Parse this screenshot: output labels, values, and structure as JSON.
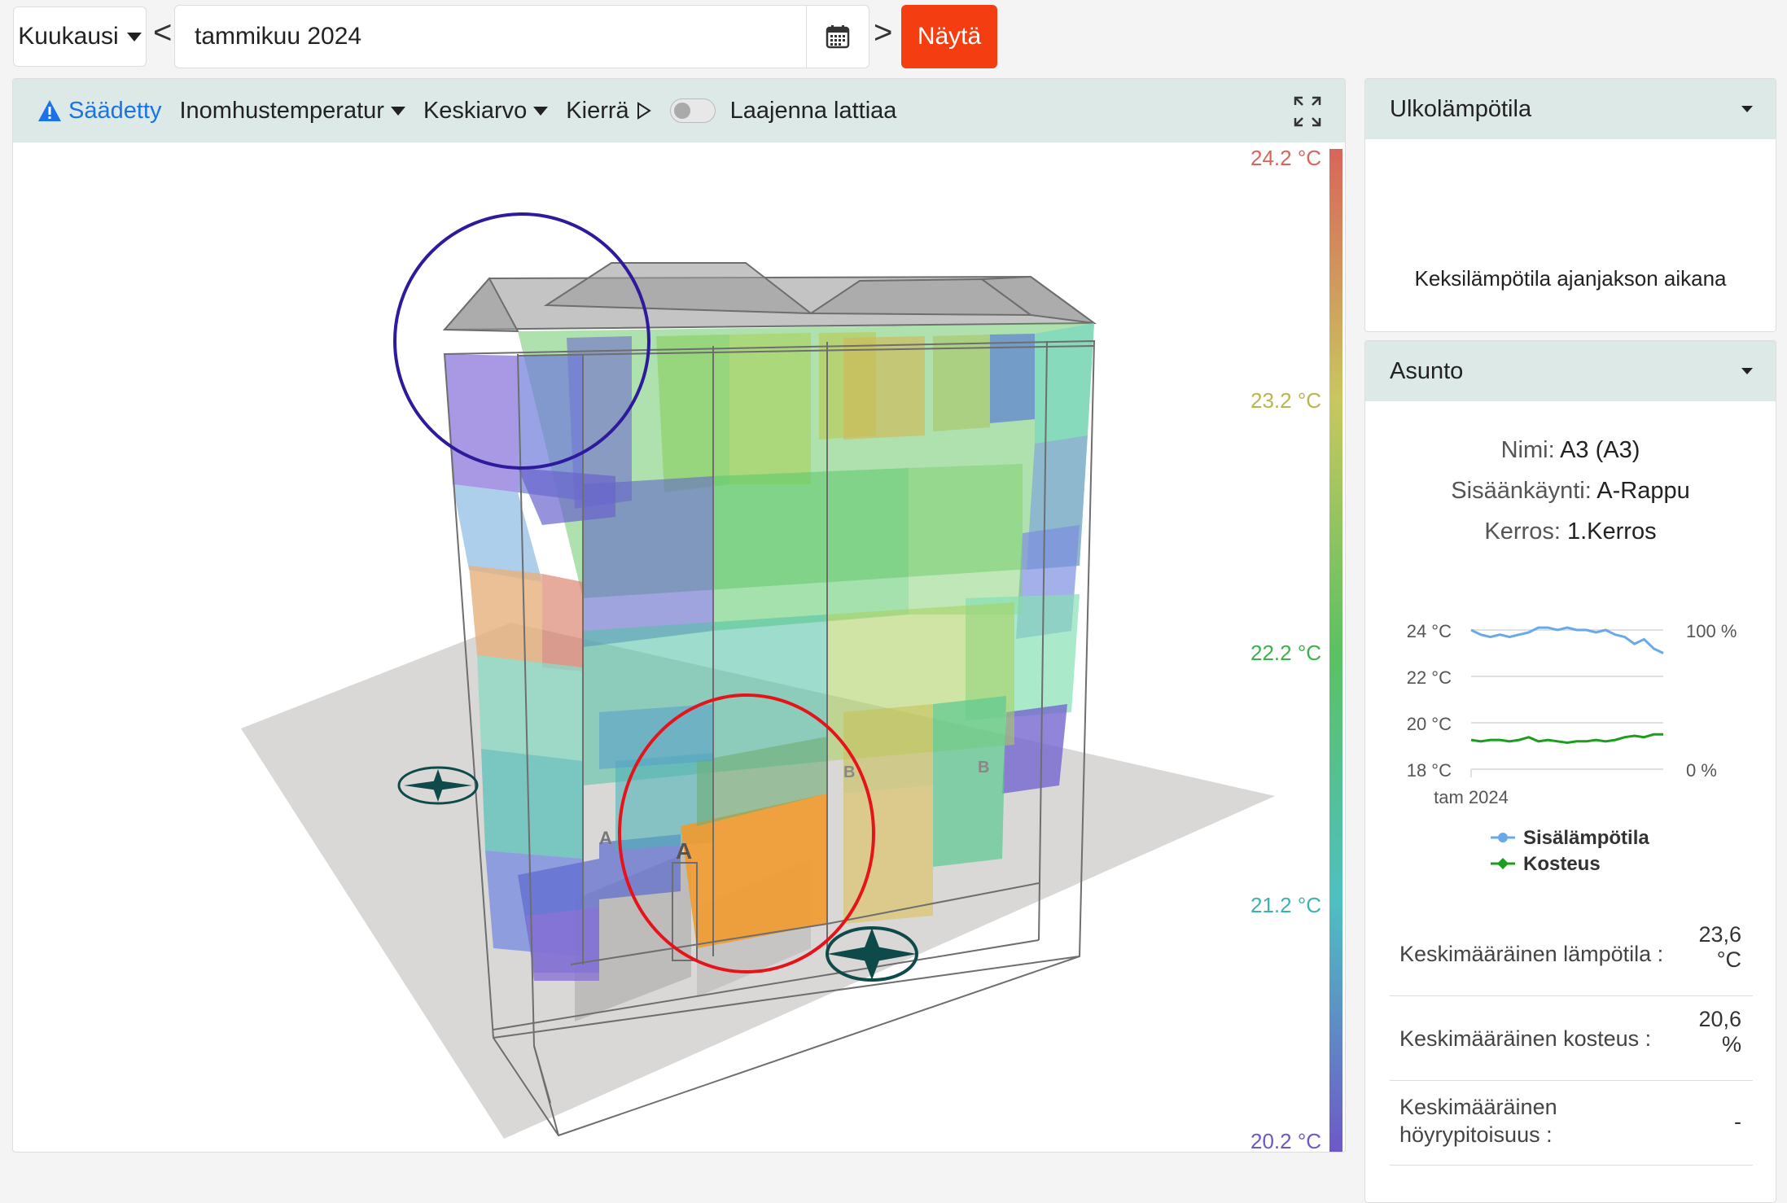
{
  "toolbar": {
    "period_label": "Kuukausi",
    "prev_label": "<",
    "next_label": ">",
    "date_value": "tammikuu 2024",
    "show_label": "Näytä"
  },
  "viewer": {
    "status_label": "Säädetty",
    "metric_label": "Inomhustemperatur",
    "aggregate_label": "Keskiarvo",
    "rotate_label": "Kierrä",
    "expand_floor_label": "Laajenna lattiaa",
    "expand_floor_on": false,
    "scale": {
      "max": "24.2 °C",
      "upper": "23.2 °C",
      "mid": "22.2 °C",
      "lower": "21.2 °C",
      "min": "20.2 °C",
      "colors": [
        "#d9655a",
        "#c9c760",
        "#5cc161",
        "#4ec0c2",
        "#6e58c8"
      ]
    },
    "entrance_labels": [
      "A",
      "A",
      "B",
      "B"
    ]
  },
  "outdoor_card": {
    "title": "Ulkolämpötila",
    "message": "Keksilämpötila ajanjakson aikana"
  },
  "apartment_card": {
    "title": "Asunto",
    "name_label": "Nimi:",
    "name_value": "A3 (A3)",
    "entrance_label": "Sisäänkäynti:",
    "entrance_value": "A-Rappu",
    "floor_label": "Kerros:",
    "floor_value": "1.Kerros",
    "chart_data": {
      "type": "line",
      "x_tick": "tam 2024",
      "y_left_ticks": [
        "24 °C",
        "22 °C",
        "20 °C",
        "18 °C"
      ],
      "y_right_ticks": [
        "100 %",
        "0 %"
      ],
      "ylim_temp": [
        18,
        24
      ],
      "ylim_humidity": [
        0,
        100
      ],
      "series": [
        {
          "name": "Sisälämpötila",
          "axis": "temp",
          "color": "#6aa9e9",
          "values": [
            24.0,
            23.8,
            23.7,
            23.8,
            23.7,
            23.8,
            23.9,
            24.1,
            24.1,
            24.0,
            24.1,
            24.0,
            24.0,
            23.9,
            24.0,
            23.8,
            23.7,
            23.4,
            23.6,
            23.2,
            23.0
          ]
        },
        {
          "name": "Kosteus",
          "axis": "humidity",
          "color": "#1b9e1b",
          "values": [
            21,
            20,
            21,
            21,
            20,
            21,
            23,
            20,
            21,
            20,
            19,
            20,
            20,
            21,
            20,
            21,
            23,
            24,
            23,
            25,
            25
          ]
        }
      ]
    },
    "stats": [
      {
        "label": "Keskimääräinen lämpötila :",
        "value_line1": "23,6",
        "value_line2": "°C"
      },
      {
        "label": "Keskimääräinen kosteus :",
        "value_line1": "20,6",
        "value_line2": "%"
      },
      {
        "label_line1": "Keskimääräinen",
        "label_line2": "höyrypitoisuus :",
        "value_line1": "-"
      }
    ]
  }
}
